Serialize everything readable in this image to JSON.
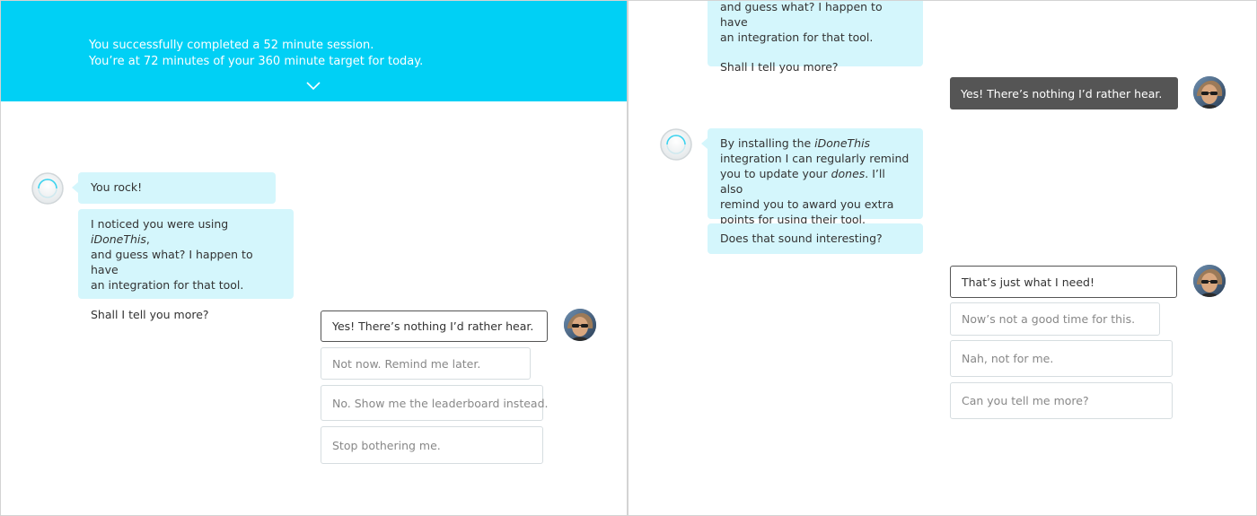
{
  "left_panel": {
    "banner": {
      "line1": "You successfully completed a 52 minute session.",
      "line2": "You’re at 72 minutes of your 360 minute target for today.",
      "icon": "chevron-down-icon"
    },
    "bot_messages": {
      "m1": "You rock!",
      "m2": {
        "t1": "I noticed you were using ",
        "em1": "iDoneThis",
        "t2": ",",
        "line2": "and guess what? I happen to have",
        "line3": "an integration for that tool.",
        "para2": "Shall I tell you more?"
      }
    },
    "options": [
      "Yes! There’s nothing I’d rather hear.",
      "Not now. Remind me later.",
      "No. Show me the leaderboard instead.",
      "Stop bothering me."
    ],
    "selected_option_index": 0
  },
  "right_panel": {
    "top_message": {
      "line1": "and guess what? I happen to have",
      "line2": "an integration for that tool.",
      "para2": "Shall I tell you more?"
    },
    "user_reply": "Yes! There’s nothing I’d rather hear.",
    "bot_messages": {
      "m1": {
        "t1": "By installing the ",
        "em1": "iDoneThis",
        "line2": "integration I can regularly remind",
        "line3_t1": "you to update your ",
        "line3_em": "dones",
        "line3_t2": ". I’ll also",
        "line4": "remind you to award you extra",
        "line5": "points for using their tool."
      },
      "m2": "Does that sound interesting?"
    },
    "options": [
      "That’s just what I need!",
      "Now’s not a good time for this.",
      "Nah, not for me.",
      "Can you tell me more?"
    ],
    "selected_option_index": 0
  },
  "colors": {
    "banner": "#00d0f5",
    "bubble": "#d4f6fc",
    "reply": "#555555",
    "border": "#d6dde0"
  }
}
